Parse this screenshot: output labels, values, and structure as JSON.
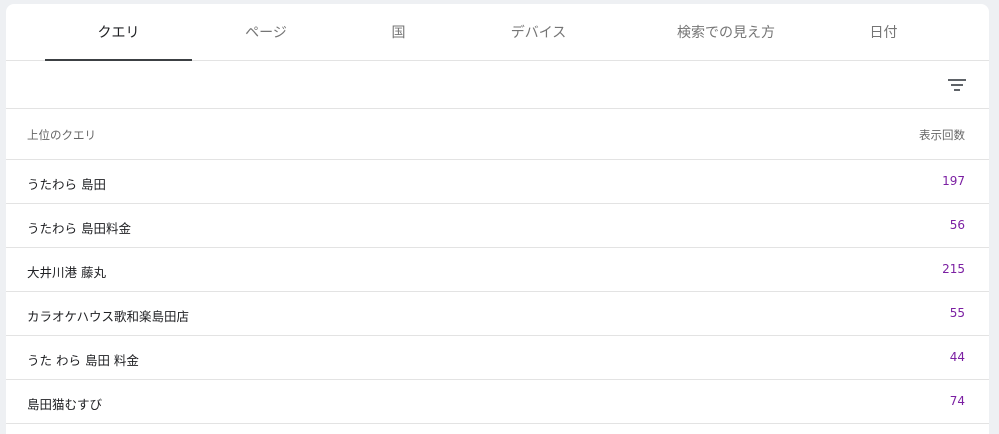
{
  "tabs": [
    {
      "label": "クエリ",
      "active": true
    },
    {
      "label": "ページ",
      "active": false
    },
    {
      "label": "国",
      "active": false
    },
    {
      "label": "デバイス",
      "active": false
    },
    {
      "label": "検索での見え方",
      "active": false
    },
    {
      "label": "日付",
      "active": false
    }
  ],
  "toolbar": {
    "filter_icon": "filter-list-icon"
  },
  "table": {
    "headers": {
      "query": "上位のクエリ",
      "impressions": "表示回数"
    },
    "rows": [
      {
        "query": "うたわら 島田",
        "impressions": "197"
      },
      {
        "query": "うたわら 島田料金",
        "impressions": "56"
      },
      {
        "query": "大井川港 藤丸",
        "impressions": "215"
      },
      {
        "query": "カラオケハウス歌和楽島田店",
        "impressions": "55"
      },
      {
        "query": "うた わら 島田 料金",
        "impressions": "44"
      },
      {
        "query": "島田猫むすび",
        "impressions": "74"
      }
    ]
  },
  "colors": {
    "value_color": "#7b1fa2",
    "active_tab_underline": "#3c4043"
  }
}
